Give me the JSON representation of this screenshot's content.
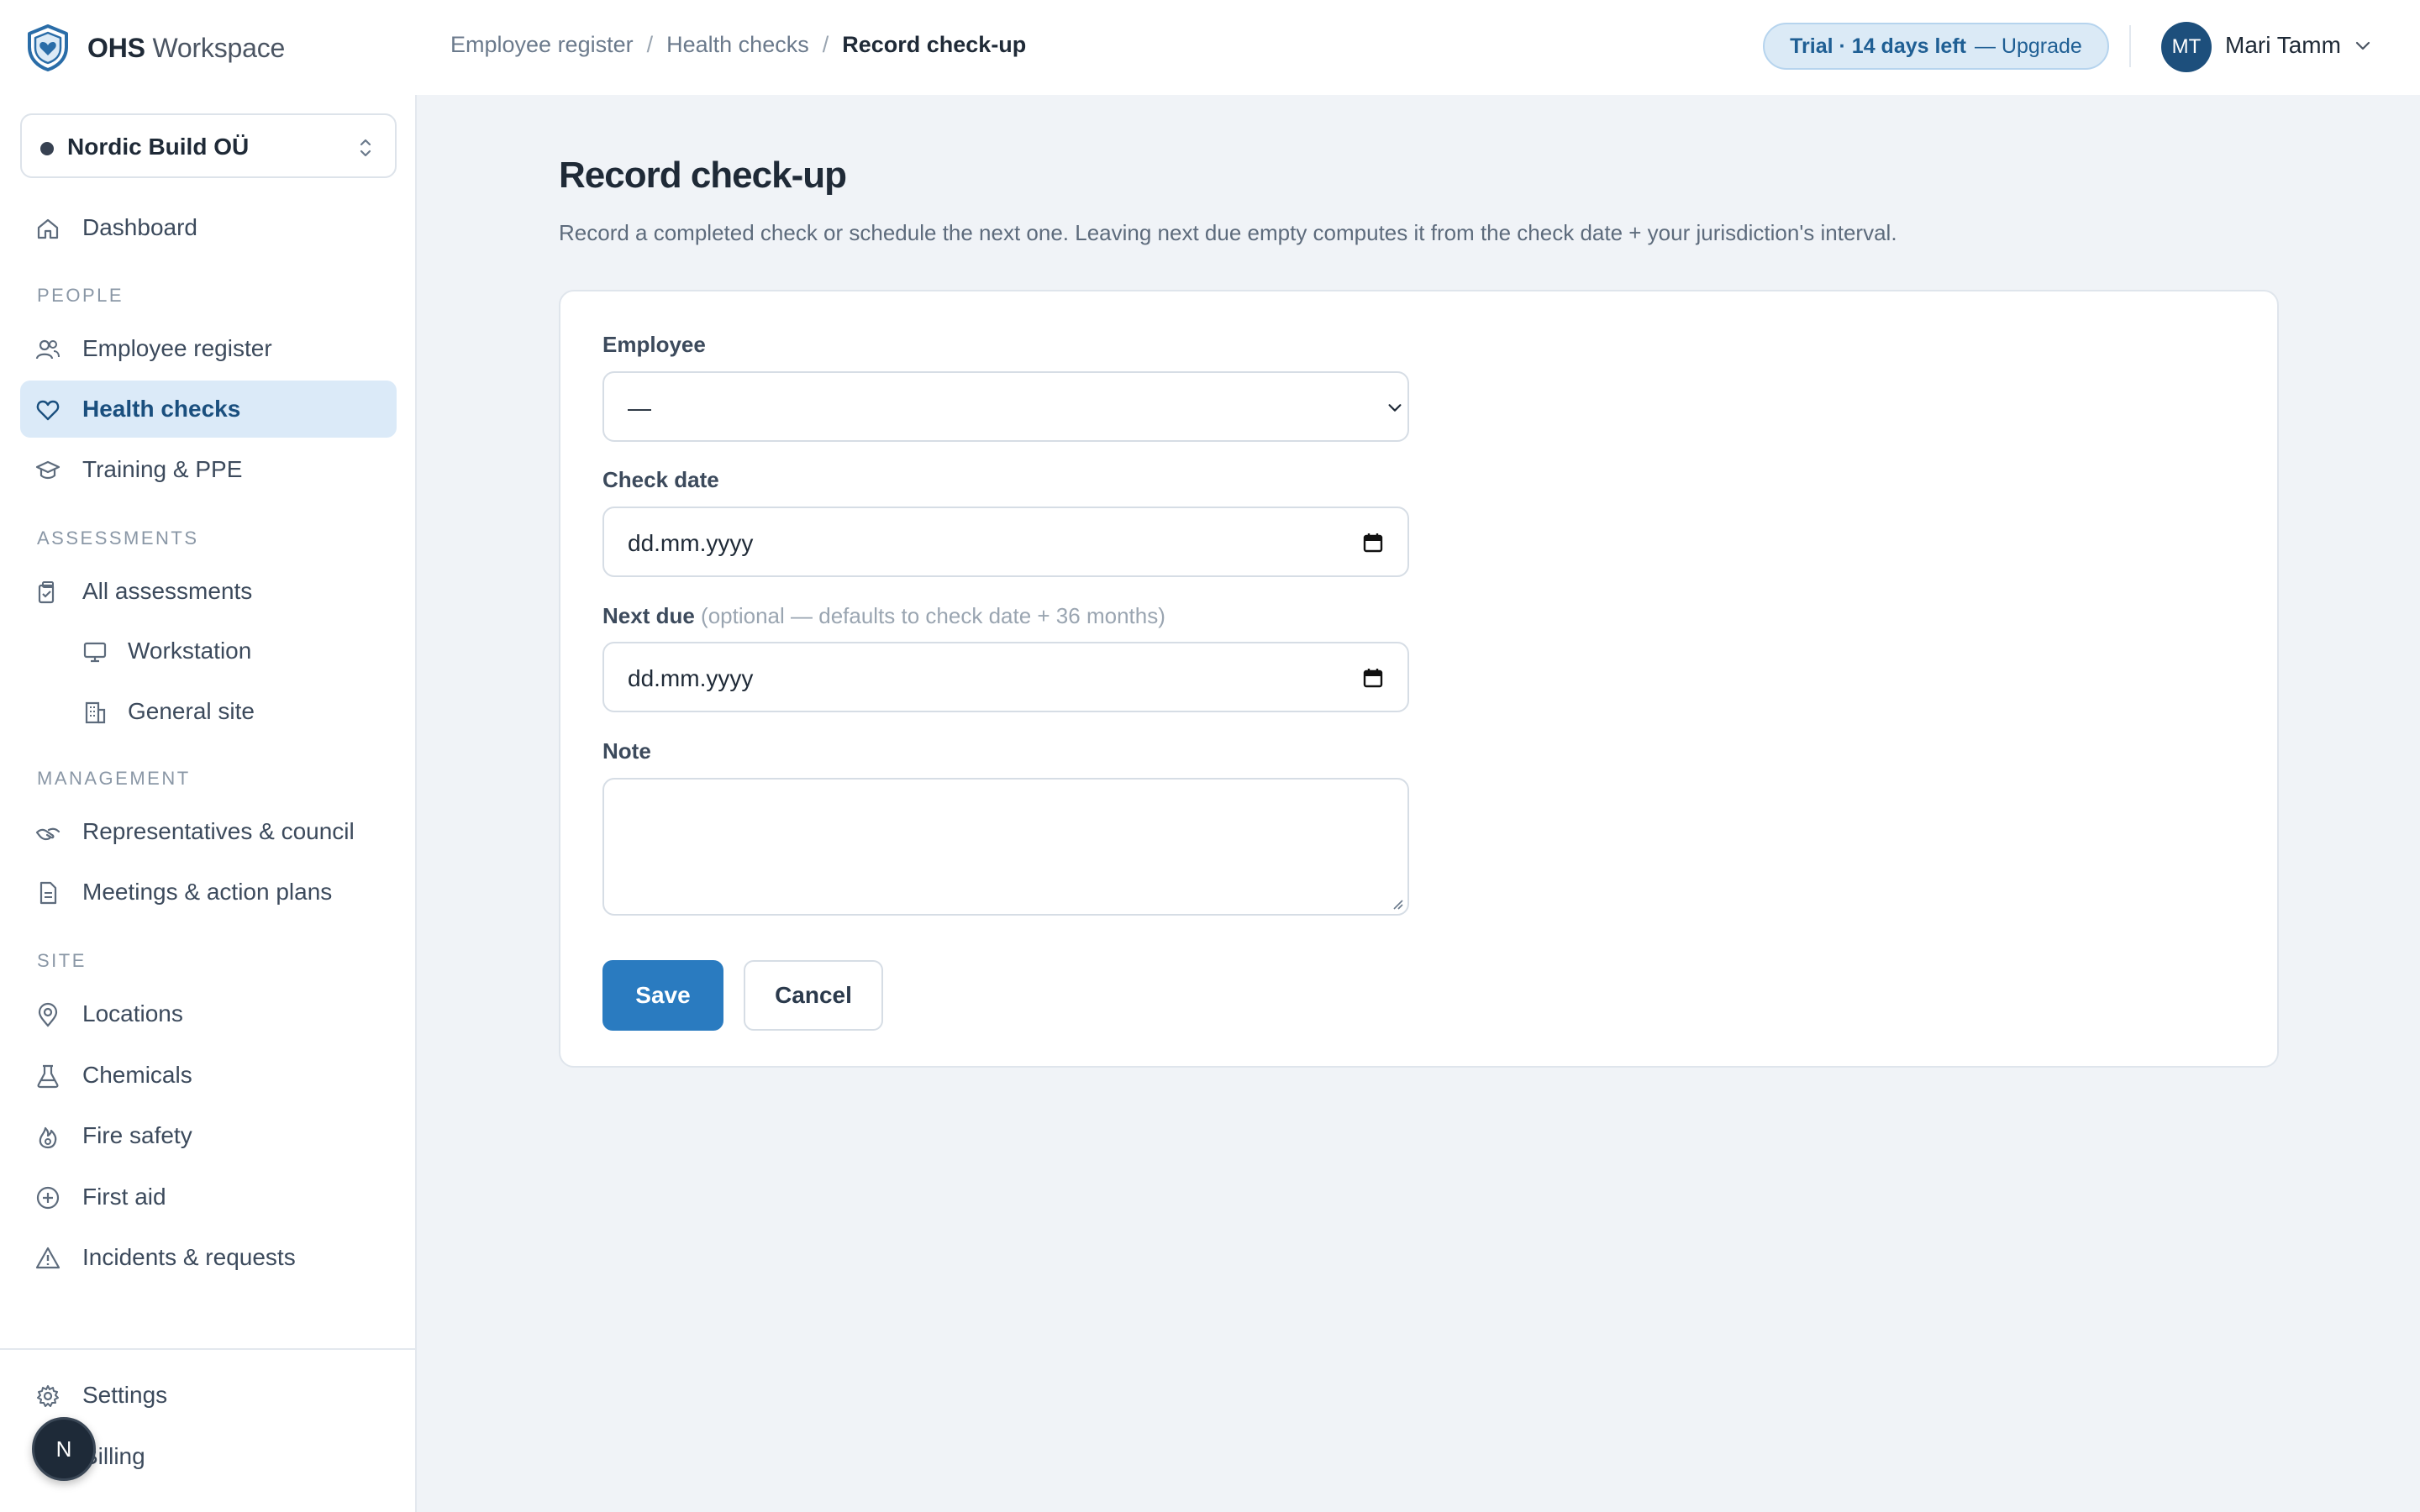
{
  "brand": {
    "name_bold": "OHS",
    "name_rest": "Workspace",
    "logo_icon": "shield-heart-icon"
  },
  "breadcrumb": {
    "items": [
      "Employee register",
      "Health checks"
    ],
    "current": "Record check-up",
    "separator": "/"
  },
  "trial": {
    "label": "Trial · 14 days left",
    "cta": "— Upgrade"
  },
  "user": {
    "initials": "MT",
    "name": "Mari Tamm"
  },
  "org": {
    "name": "Nordic Build OÜ"
  },
  "sidebar": {
    "dashboard": "Dashboard",
    "sections": {
      "people": "PEOPLE",
      "assessments": "ASSESSMENTS",
      "management": "MANAGEMENT",
      "site": "SITE"
    },
    "employee_register": "Employee register",
    "health_checks": "Health checks",
    "training_ppe": "Training & PPE",
    "all_assessments": "All assessments",
    "workstation": "Workstation",
    "general_site": "General site",
    "representatives": "Representatives & council",
    "meetings": "Meetings & action plans",
    "locations": "Locations",
    "chemicals": "Chemicals",
    "fire_safety": "Fire safety",
    "first_aid": "First aid",
    "incidents": "Incidents & requests",
    "settings": "Settings",
    "billing": "Billing"
  },
  "fab": {
    "label": "N"
  },
  "page": {
    "title": "Record check-up",
    "description": "Record a completed check or schedule the next one. Leaving next due empty computes it from the check date + your jurisdiction's interval."
  },
  "form": {
    "employee_label": "Employee",
    "employee_value": "—",
    "check_date_label": "Check date",
    "check_date_value": "dd.mm.yyyy",
    "next_due_label": "Next due",
    "next_due_hint": "(optional — defaults to check date + 36 months)",
    "next_due_value": "dd.mm.yyyy",
    "note_label": "Note",
    "note_value": "",
    "save_label": "Save",
    "cancel_label": "Cancel"
  },
  "colors": {
    "accent": "#2a7bc0",
    "active_bg": "#dbeaf8",
    "trial_bg": "#dbeaf6",
    "avatar": "#1d4f7c"
  }
}
